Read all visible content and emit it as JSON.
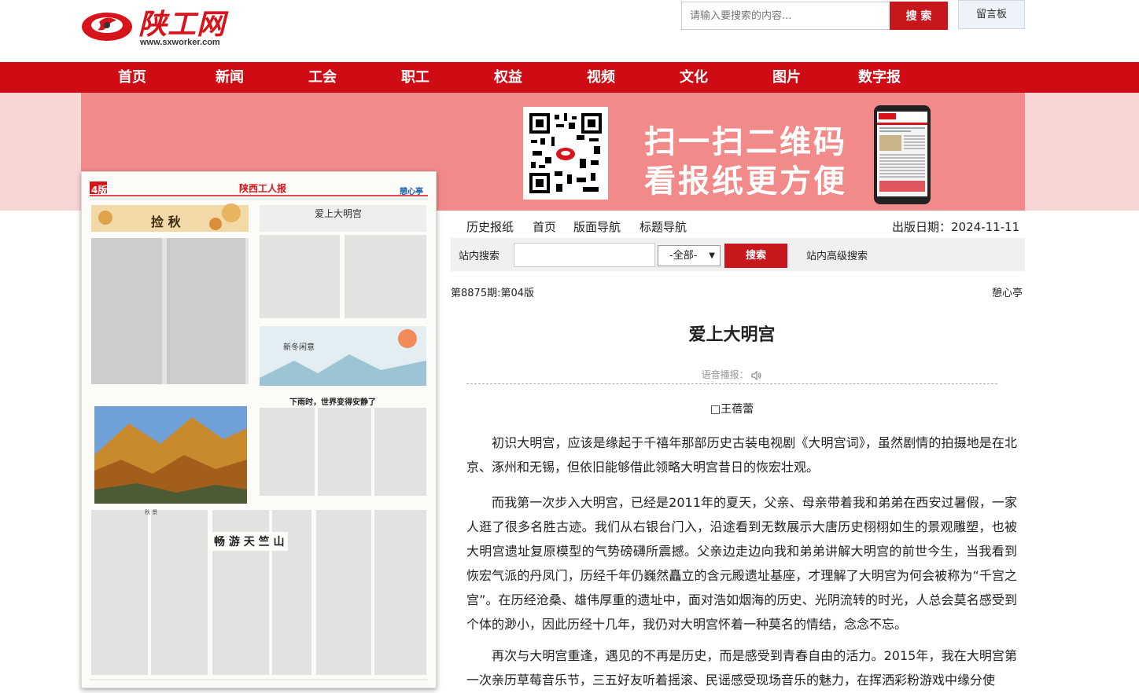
{
  "header": {
    "logo_name": "陕工网",
    "logo_url": "www.sxworker.com",
    "search_placeholder": "请输入要搜索的内容...",
    "search_button": "搜 索",
    "message_board": "留言板"
  },
  "nav": {
    "items": [
      "首页",
      "新闻",
      "工会",
      "职工",
      "权益",
      "视频",
      "文化",
      "图片",
      "数字报"
    ]
  },
  "banner": {
    "line1": "扫一扫二维码",
    "line2": "看报纸更方便"
  },
  "newspaper": {
    "page_label": "4版",
    "masthead": "陕西工人报",
    "section": "憩心亭",
    "headline_1": "捡 秋",
    "headline_2": "爱上大明宫",
    "headline_3": "新冬闲意",
    "headline_4": "下雨时，世界变得安静了",
    "headline_5": "畅 游 天 竺 山",
    "photo_caption": "秋 景"
  },
  "subnav": {
    "items": [
      "历史报纸",
      "首页",
      "版面导航",
      "标题导航"
    ],
    "pub_date_label": "出版日期：",
    "pub_date": "2024-11-11"
  },
  "site_search": {
    "label": "站内搜索",
    "select_value": "-全部-",
    "button": "搜索",
    "advanced": "站内高级搜索"
  },
  "article": {
    "issue": "第8875期:第04版",
    "section": "憩心亭",
    "title": "爱上大明宫",
    "tts_label": "语音播报：",
    "author": "□王蓓蕾",
    "paragraphs": [
      "初识大明宫，应该是缘起于千禧年那部历史古装电视剧《大明宫词》，虽然剧情的拍摄地是在北京、涿州和无锡，但依旧能够借此领略大明宫昔日的恢宏壮观。",
      "而我第一次步入大明宫，已经是2011年的夏天，父亲、母亲带着我和弟弟在西安过暑假，一家人逛了很多名胜古迹。我们从右银台门入，沿途看到无数展示大唐历史栩栩如生的景观雕塑，也被大明宫遗址复原模型的气势磅礴所震撼。父亲边走边向我和弟弟讲解大明宫的前世今生，当我看到恢宏气派的丹凤门，历经千年仍巍然矗立的含元殿遗址基座，才理解了大明宫为何会被称为“千宫之宫”。在历经沧桑、雄伟厚重的遗址中，面对浩如烟海的历史、光阴流转的时光，人总会莫名感受到个体的渺小，因此历经十几年，我仍对大明宫怀着一种莫名的情结，念念不忘。",
      "再次与大明宫重逢，遇见的不再是历史，而是感受到青春自由的活力。2015年，我在大明宫第一次亲历草莓音乐节，三五好友听着摇滚、民谣感受现场音乐的魅力，在挥洒彩粉游戏中缘分使"
    ]
  },
  "colors": {
    "brand_red": "#cf0c14",
    "banner_pink": "#f28a89",
    "banner_bg": "#f9d6d6"
  }
}
